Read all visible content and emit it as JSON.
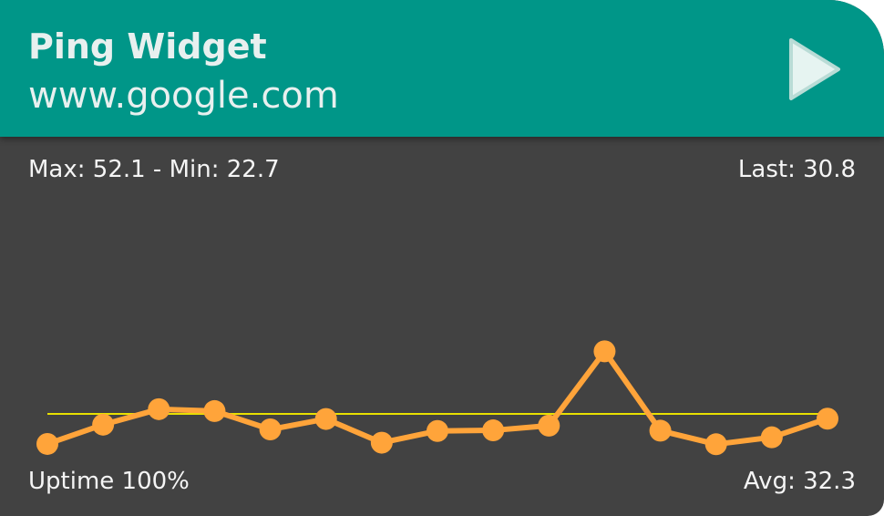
{
  "header": {
    "title": "Ping Widget",
    "host": "www.google.com",
    "play_icon": "play-icon"
  },
  "stats": {
    "max_min": "Max: 52.1 - Min: 22.7",
    "last": "Last: 30.8",
    "uptime": "Uptime 100%",
    "avg": "Avg: 32.3"
  },
  "colors": {
    "header": "#009688",
    "body": "#424242",
    "line": "#ffa43a",
    "average": "#e8e000",
    "text": "#f5f5f5"
  },
  "chart_data": {
    "type": "line",
    "x": [
      1,
      2,
      3,
      4,
      5,
      6,
      7,
      8,
      9,
      10,
      11,
      12,
      13,
      14,
      15
    ],
    "series": [
      {
        "values": [
          22.8,
          28.9,
          33.8,
          33.2,
          27.4,
          30.7,
          23.2,
          26.9,
          27.1,
          28.6,
          52.1,
          27.0,
          22.7,
          24.9,
          30.8
        ]
      }
    ],
    "average": 32.3,
    "ylim": [
      0,
      120
    ],
    "grid": false,
    "legend": "none"
  }
}
